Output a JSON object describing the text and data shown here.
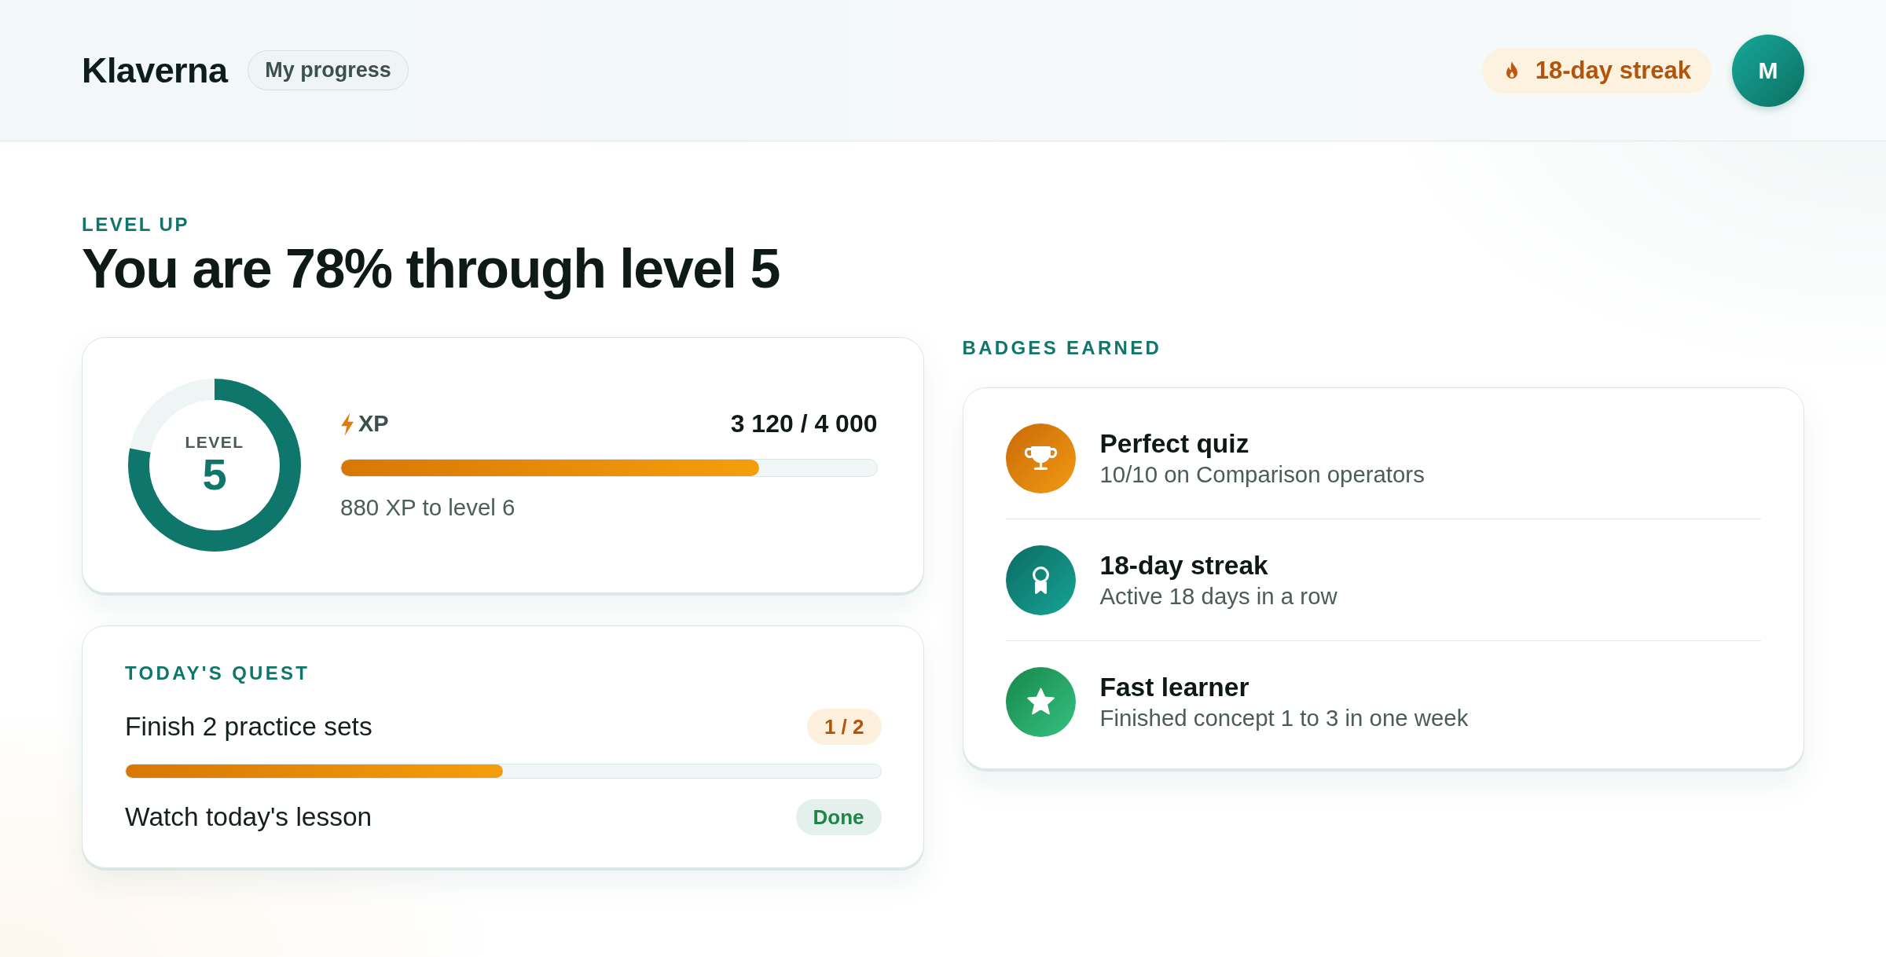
{
  "header": {
    "logo": "Klaverna",
    "page_tag": "My progress",
    "streak": "18-day streak",
    "avatar": "M"
  },
  "hero": {
    "eyebrow": "LEVEL UP",
    "title": "You are 78% through level 5"
  },
  "level_card": {
    "ring": {
      "label": "LEVEL",
      "value": "5",
      "level": 0.78
    },
    "xp": {
      "label": "XP",
      "reading": "3 120 / 4 000",
      "level": 0.78,
      "note": "880 XP to level 6"
    }
  },
  "quest": {
    "heading": "TODAY'S QUEST",
    "items": [
      {
        "kind": "progress",
        "label": "Finish 2 practice sets",
        "count": "1 / 2",
        "level": 0.5
      },
      {
        "kind": "done",
        "label": "Watch today's lesson",
        "status": "Done"
      }
    ]
  },
  "badges": {
    "heading": "BADGES EARNED",
    "items": [
      {
        "kind": "trophy",
        "title": "Perfect quiz",
        "detail": "10/10 on Comparison operators"
      },
      {
        "kind": "medal",
        "title": "18-day streak",
        "detail": "Active 18 days in a row"
      },
      {
        "kind": "star",
        "title": "Fast learner",
        "detail": "Finished concept 1 to 3 in one week"
      }
    ]
  }
}
